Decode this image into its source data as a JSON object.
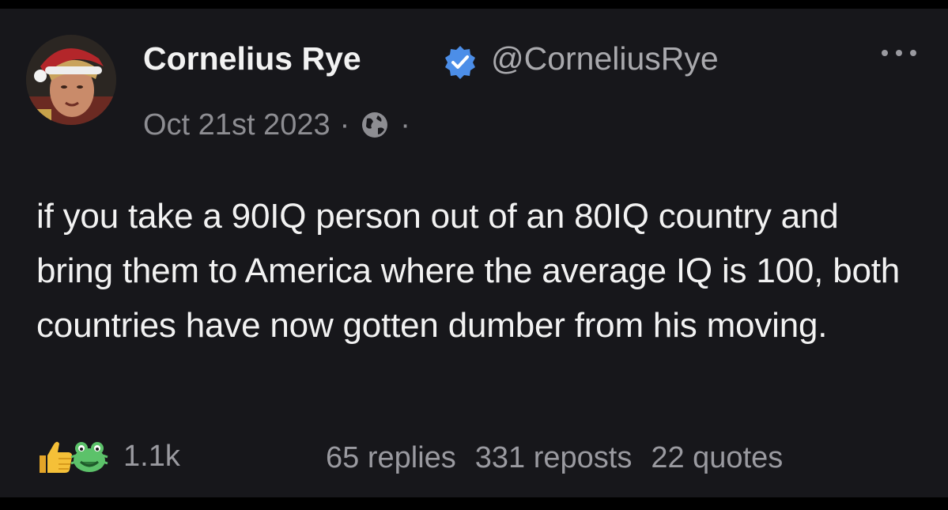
{
  "post": {
    "author_name": "Cornelius Rye",
    "handle": "@CorneliusRye",
    "date": "Oct 21st 2023",
    "separator": "·",
    "visibility_icon": "globe-icon",
    "verified_icon": "verified-badge-icon",
    "more_icon": "more-options-icon",
    "text": "if you take a 90IQ person out of an 80IQ country and bring them to America where the average IQ is 100, both countries have now gotten dumber from his moving.",
    "reactions": {
      "icons": [
        "thumbs-up-icon",
        "frog-emoji-icon"
      ],
      "count": "1.1k"
    },
    "stats": {
      "replies": "65 replies",
      "reposts": "331 reposts",
      "quotes": "22 quotes"
    }
  },
  "colors": {
    "background": "#17171b",
    "text_primary": "#f2f2f2",
    "text_secondary": "#9a9aa0",
    "verified": "#4c8ee8"
  }
}
